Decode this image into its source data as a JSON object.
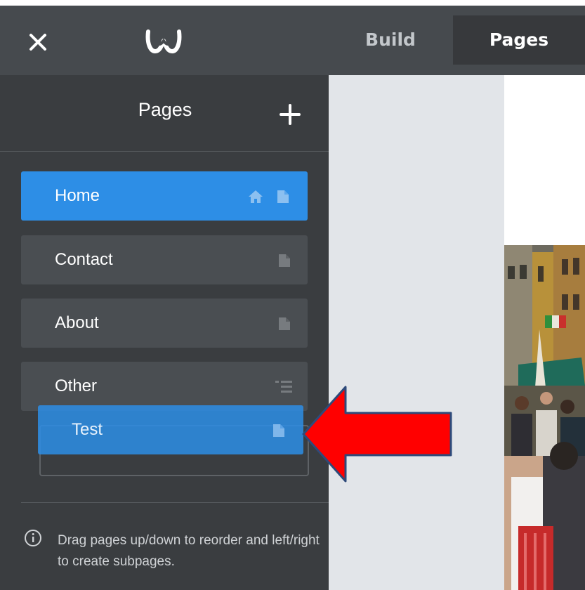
{
  "topbar": {
    "close_icon": "close-icon",
    "logo_icon": "weebly-logo-icon",
    "tabs": [
      {
        "label": "Build",
        "active": false
      },
      {
        "label": "Pages",
        "active": true
      }
    ]
  },
  "sidebar": {
    "title": "Pages",
    "add_icon": "plus-icon",
    "pages": [
      {
        "label": "Home",
        "active": true,
        "icons": [
          "home-icon",
          "page-icon"
        ]
      },
      {
        "label": "Contact",
        "active": false,
        "icons": [
          "page-icon"
        ]
      },
      {
        "label": "About",
        "active": false,
        "icons": [
          "page-icon"
        ]
      },
      {
        "label": "Other",
        "active": false,
        "icons": [
          "menu-list-icon"
        ]
      }
    ],
    "dragging_page": {
      "label": "Test",
      "icons": [
        "page-icon"
      ]
    },
    "help_text": "Drag pages up/down to reorder and left/right to create subpages.",
    "info_icon": "info-icon"
  },
  "annotation": {
    "arrow_icon": "red-arrow-icon",
    "color": "#ff0000"
  },
  "colors": {
    "accent": "#2d8ee6",
    "topbar": "#464a4e",
    "sidebar": "#3a3d40",
    "item": "#4a4e52"
  }
}
